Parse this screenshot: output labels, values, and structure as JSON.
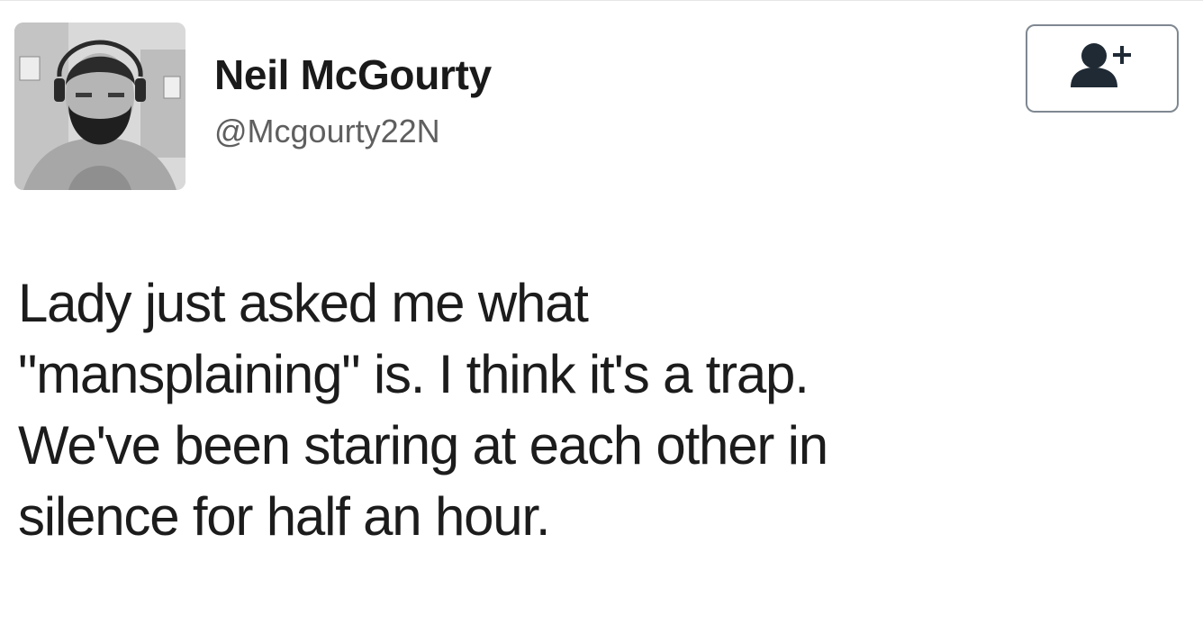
{
  "tweet": {
    "author": {
      "display_name": "Neil McGourty",
      "handle": "@Mcgourty22N"
    },
    "follow_button": {
      "icon": "add-user-icon"
    },
    "text_lines": [
      "Lady just asked me what",
      "\"mansplaining\" is. I think it's a trap.",
      "We've been staring at each other in",
      "silence for half an hour."
    ]
  },
  "colors": {
    "text": "#1c1c1c",
    "handle": "#5f5f5f",
    "button_border": "#7f8891",
    "icon": "#1f2a35"
  }
}
